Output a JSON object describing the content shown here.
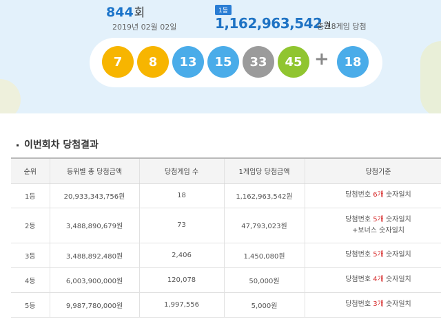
{
  "draw": {
    "number": "844",
    "suffix": "회",
    "date": "2019년 02월 02일",
    "rank_badge": "1등",
    "jackpot": "1,162,963,542",
    "jackpot_unit": "원",
    "winners_note": "총 18게임 당첨"
  },
  "balls": [
    {
      "number": "7",
      "color": "#f7b500"
    },
    {
      "number": "8",
      "color": "#f7b500"
    },
    {
      "number": "13",
      "color": "#4aace9"
    },
    {
      "number": "15",
      "color": "#4aace9"
    },
    {
      "number": "33",
      "color": "#9b9b9b"
    },
    {
      "number": "45",
      "color": "#90c530"
    }
  ],
  "plus_sign": "+",
  "bonus": {
    "number": "18",
    "color": "#4aace9"
  },
  "section_title": "이번회차 당첨결과",
  "table": {
    "headers": [
      "순위",
      "등위별 총 당첨금액",
      "당첨게임 수",
      "1게임당 당첨금액",
      "당첨기준"
    ],
    "rows": [
      {
        "rank": "1등",
        "total": "20,933,343,756원",
        "games": "18",
        "per_game": "1,162,963,542원",
        "crit_a": "당첨번호 ",
        "crit_hl": "6개",
        "crit_b": " 숫자일치",
        "crit_line2": ""
      },
      {
        "rank": "2등",
        "total": "3,488,890,679원",
        "games": "73",
        "per_game": "47,793,023원",
        "crit_a": "당첨번호 ",
        "crit_hl": "5개",
        "crit_b": " 숫자일치",
        "crit_line2": "+보너스 숫자일치"
      },
      {
        "rank": "3등",
        "total": "3,488,892,480원",
        "games": "2,406",
        "per_game": "1,450,080원",
        "crit_a": "당첨번호 ",
        "crit_hl": "5개",
        "crit_b": " 숫자일치",
        "crit_line2": ""
      },
      {
        "rank": "4등",
        "total": "6,003,900,000원",
        "games": "120,078",
        "per_game": "50,000원",
        "crit_a": "당첨번호 ",
        "crit_hl": "4개",
        "crit_b": " 숫자일치",
        "crit_line2": ""
      },
      {
        "rank": "5등",
        "total": "9,987,780,000원",
        "games": "1,997,556",
        "per_game": "5,000원",
        "crit_a": "당첨번호 ",
        "crit_hl": "3개",
        "crit_b": " 숫자일치",
        "crit_line2": ""
      }
    ]
  }
}
